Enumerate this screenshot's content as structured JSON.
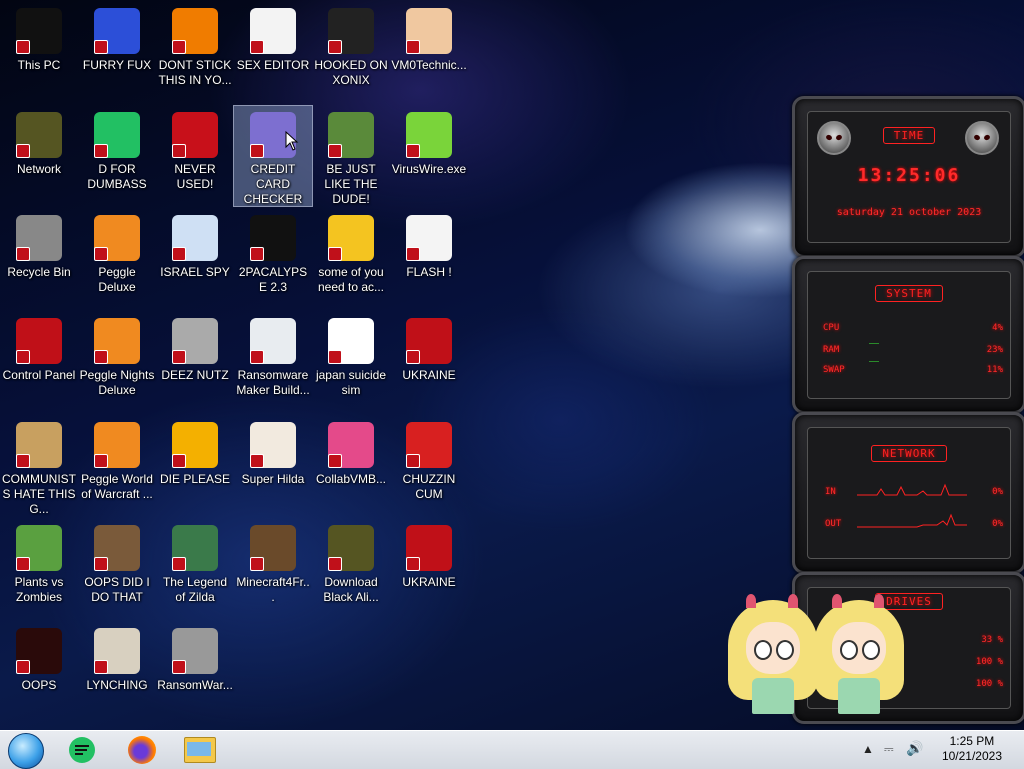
{
  "desktop": {
    "icons": [
      {
        "label": "This PC",
        "icon": "monitor-icon",
        "bg": "#111111",
        "fg": "#c00"
      },
      {
        "label": "FURRY FUX",
        "icon": "firefox-icon",
        "bg": "#2c4fd8",
        "fg": "#ff8a00"
      },
      {
        "label": "DONT STICK THIS IN YO...",
        "icon": "vlc-cone-icon",
        "bg": "#f07c00",
        "fg": "#fff"
      },
      {
        "label": "SEX EDITOR",
        "icon": "hxd-editor-icon",
        "bg": "#f3f3f3",
        "fg": "#4a4"
      },
      {
        "label": "HOOKED ON XONIX",
        "icon": "xonix-game-icon",
        "bg": "#222",
        "fg": "#d22"
      },
      {
        "label": "VM0Technic...",
        "icon": "doctor-person-icon",
        "bg": "#f0c8a0",
        "fg": "#fff"
      },
      {
        "label": "Network",
        "icon": "red-alien-icon",
        "bg": "#552",
        "fg": "#c22"
      },
      {
        "label": "D FOR DUMBASS",
        "icon": "green-app-icon",
        "bg": "#22c063",
        "fg": "#111"
      },
      {
        "label": "NEVER USED!",
        "icon": "devcpp-icon",
        "bg": "#c8101a",
        "fg": "#fff"
      },
      {
        "label": "CREDIT CARD CHECKER",
        "icon": "credit-card-icon",
        "bg": "#7d6fd0",
        "fg": "#fff"
      },
      {
        "label": "BE JUST LIKE THE DUDE!",
        "icon": "bonzi-elf-icon",
        "bg": "#5a8a3a",
        "fg": "#fff"
      },
      {
        "label": "VirusWire.exe",
        "icon": "lime-wire-icon",
        "bg": "#7ad43a",
        "fg": "#fff"
      },
      {
        "label": "Recycle Bin",
        "icon": "recycle-bin-icon",
        "bg": "#888",
        "fg": "#c00"
      },
      {
        "label": "Peggle Deluxe",
        "icon": "peggle-icon",
        "bg": "#f08a20",
        "fg": "#c22"
      },
      {
        "label": "ISRAEL SPY",
        "icon": "network-spy-icon",
        "bg": "#cfe0f4",
        "fg": "#246"
      },
      {
        "label": "2PACALYPSE 2.3",
        "icon": "terminal-icon",
        "bg": "#111",
        "fg": "#ddd"
      },
      {
        "label": "some of you need to ac...",
        "icon": "cartoon-dog-icon",
        "bg": "#f4c420",
        "fg": "#8a4a10"
      },
      {
        "label": "FLASH !",
        "icon": "flash-document-icon",
        "bg": "#f4f4f4",
        "fg": "#c00"
      },
      {
        "label": "Control Panel",
        "icon": "control-panel-icon",
        "bg": "#c01018",
        "fg": "#fff"
      },
      {
        "label": "Peggle Nights Deluxe",
        "icon": "peggle-nights-icon",
        "bg": "#f08a20",
        "fg": "#3366cc"
      },
      {
        "label": "DEEZ NUTZ",
        "icon": "stacked-windows-icon",
        "bg": "#aaaaaa",
        "fg": "#333"
      },
      {
        "label": "Ransomware Maker Build...",
        "icon": "app-window-icon",
        "bg": "#e8ecf0",
        "fg": "#3a8"
      },
      {
        "label": "japan suicide sim",
        "icon": "document-icon",
        "bg": "#ffffff",
        "fg": "#333"
      },
      {
        "label": "UKRAINE",
        "icon": "radiation-icon",
        "bg": "#c01018",
        "fg": "#111"
      },
      {
        "label": "COMMUNISTS HATE THIS G...",
        "icon": "money-bag-icon",
        "bg": "#c8a060",
        "fg": "#333"
      },
      {
        "label": "Peggle World of Warcraft ...",
        "icon": "peggle-wow-icon",
        "bg": "#f08a20",
        "fg": "#c22"
      },
      {
        "label": "DIE PLEASE",
        "icon": "de-editor-icon",
        "bg": "#f4b000",
        "fg": "#222"
      },
      {
        "label": "Super Hilda",
        "icon": "pixel-cat-icon",
        "bg": "#f2eadf",
        "fg": "#333"
      },
      {
        "label": "CollabVMB...",
        "icon": "collab-screen-icon",
        "bg": "#e44a8a",
        "fg": "#fff"
      },
      {
        "label": "CHUZZIN CUM",
        "icon": "red-chuzzle-icon",
        "bg": "#d82020",
        "fg": "#fff"
      },
      {
        "label": "Plants vs Zombies",
        "icon": "flower-icon",
        "bg": "#5aa040",
        "fg": "#fff"
      },
      {
        "label": "OOPS DID I DO THAT",
        "icon": "portrait-icon",
        "bg": "#7a5a3a",
        "fg": "#fff"
      },
      {
        "label": "The Legend of Zilda",
        "icon": "pixel-hero-icon",
        "bg": "#3a7a4a",
        "fg": "#fff"
      },
      {
        "label": "Minecraft4Fr...",
        "icon": "minecraft-block-icon",
        "bg": "#6a4a2a",
        "fg": "#5a3"
      },
      {
        "label": "Download Black Ali...",
        "icon": "red-alien-icon",
        "bg": "#552",
        "fg": "#c22"
      },
      {
        "label": "UKRAINE",
        "icon": "radiation-icon",
        "bg": "#c01018",
        "fg": "#111"
      },
      {
        "label": "OOPS",
        "icon": "red-monitor-icon",
        "bg": "#2a0a0a",
        "fg": "#c00"
      },
      {
        "label": "LYNCHING",
        "icon": "rope-icon",
        "bg": "#d8d0c0",
        "fg": "#444"
      },
      {
        "label": "RansomWar...",
        "icon": "skull-icon",
        "bg": "#999",
        "fg": "#111"
      }
    ]
  },
  "gadgets": {
    "time": {
      "title": "TIME",
      "clock": "13:25:06",
      "date": "saturday 21 october 2023"
    },
    "system": {
      "title": "SYSTEM",
      "rows": [
        {
          "label": "CPU",
          "value": "4%"
        },
        {
          "label": "RAM",
          "value": "23%"
        },
        {
          "label": "SWAP",
          "value": "11%"
        }
      ]
    },
    "network": {
      "title": "NETWORK",
      "rows": [
        {
          "label": "IN",
          "value": "0%"
        },
        {
          "label": "OUT",
          "value": "0%"
        }
      ]
    },
    "drives": {
      "title": "DRIVES",
      "rows": [
        {
          "value": "33 %"
        },
        {
          "value": "100 %"
        },
        {
          "value": "100 %"
        }
      ]
    }
  },
  "taskbar": {
    "pinned": [
      {
        "name": "green-app-taskbar-icon",
        "color": "#22c063"
      },
      {
        "name": "firefox-taskbar-icon",
        "color": "#ff7a00"
      },
      {
        "name": "file-explorer-taskbar-icon",
        "color": "#f4c84a"
      }
    ],
    "tray": {
      "time": "1:25 PM",
      "date": "10/21/2023"
    }
  },
  "colors": {
    "gadget_red": "#ff2222",
    "selection": "#96aad2"
  }
}
